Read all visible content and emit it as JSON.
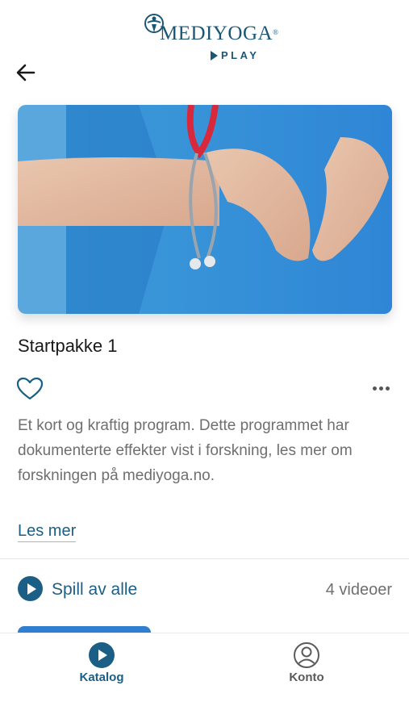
{
  "brand": {
    "name": "MEDIYOGA",
    "reg": "®",
    "sub": "PLAY",
    "color": "#1b5775"
  },
  "nav": {
    "back_icon": "arrow-left-icon"
  },
  "program": {
    "title": "Startpakke 1",
    "description": "Et kort og kraftig program. Dette programmet har dokumenterte effekter vist i forskning, les mer om forskningen på mediyoga.no.",
    "read_more": "Les mer",
    "favorite_icon": "heart-outline-icon",
    "more_icon": "more-horizontal-icon",
    "image": "nurse-heart-hands-photo"
  },
  "playlist": {
    "play_all_label": "Spill av alle",
    "video_count": "4 videoer",
    "accent": "#1b5f86"
  },
  "tabbar": {
    "items": [
      {
        "label": "Katalog",
        "icon": "play-circle-icon",
        "active": true
      },
      {
        "label": "Konto",
        "icon": "user-circle-icon",
        "active": false
      }
    ]
  }
}
